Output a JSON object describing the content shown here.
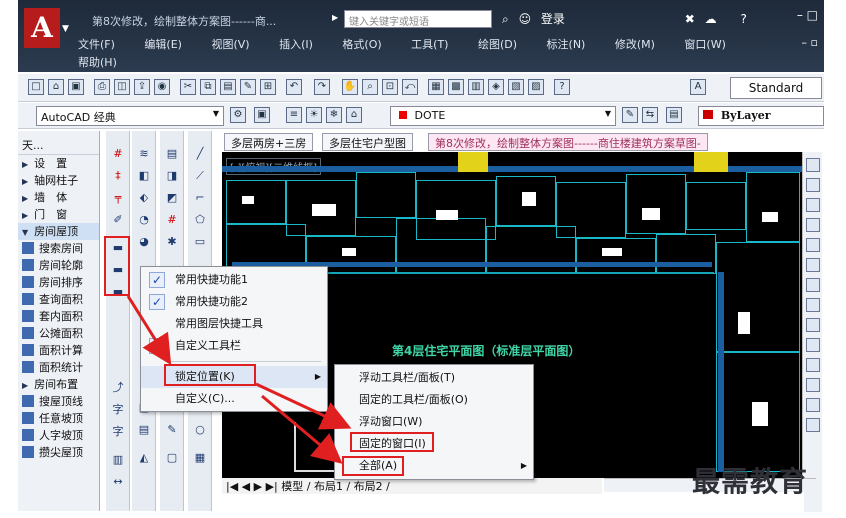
{
  "title_bar": {
    "title": "第8次修改，绘制整体方案图------商...",
    "search_placeholder": "键入关键字或短语",
    "login_label": "登录",
    "window_min": "–",
    "window_max": "□",
    "help": "?"
  },
  "menus": [
    "文件(F)",
    "编辑(E)",
    "视图(V)",
    "插入(I)",
    "格式(O)",
    "工具(T)",
    "绘图(D)",
    "标注(N)",
    "修改(M)",
    "窗口(W)"
  ],
  "menu_help": "帮助(H)",
  "toolbar": {
    "style_value": "Standard",
    "workspace_value": "AutoCAD 经典",
    "layer_value": "DOTE",
    "color_value": "ByLayer"
  },
  "left_panel": {
    "header": "天...",
    "groups": [
      "设　置",
      "轴网柱子",
      "墙　体",
      "门　窗",
      "房间屋顶"
    ],
    "items": [
      "搜索房间",
      "房间轮廓",
      "房间排序",
      "查询面积",
      "套内面积",
      "公摊面积",
      "面积计算",
      "面积统计",
      "房间布置",
      "搜屋顶线",
      "任意坡顶",
      "人字坡顶",
      "攒尖屋顶"
    ]
  },
  "doc_tabs": [
    "多层两房+三房",
    "多层住宅户型图",
    "第8次修改，绘制整体方案图------商住楼建筑方案草图-"
  ],
  "canvas": {
    "view_label": "[-][俯视][二维线框]",
    "caption": "第4层住宅平面图（标准层平面图）"
  },
  "layout_tabs": [
    "模型",
    "布局1",
    "布局2"
  ],
  "context_menu": {
    "items": [
      {
        "label": "常用快捷功能1",
        "checked": true
      },
      {
        "label": "常用快捷功能2",
        "checked": true
      },
      {
        "label": "常用图层快捷工具",
        "checked": false
      },
      {
        "label": "自定义工具栏",
        "checked": true
      }
    ],
    "lock_position": "锁定位置(K)",
    "customize": "自定义(C)..."
  },
  "submenu": {
    "items": [
      "浮动工具栏/面板(T)",
      "固定的工具栏/面板(O)",
      "浮动窗口(W)",
      "固定的窗口(I)",
      "全部(A)"
    ]
  },
  "watermark": "最需教育",
  "colors": {
    "accent_red": "#e02020",
    "canvas_bg": "#000000",
    "wall_cyan": "#19b8c9"
  }
}
